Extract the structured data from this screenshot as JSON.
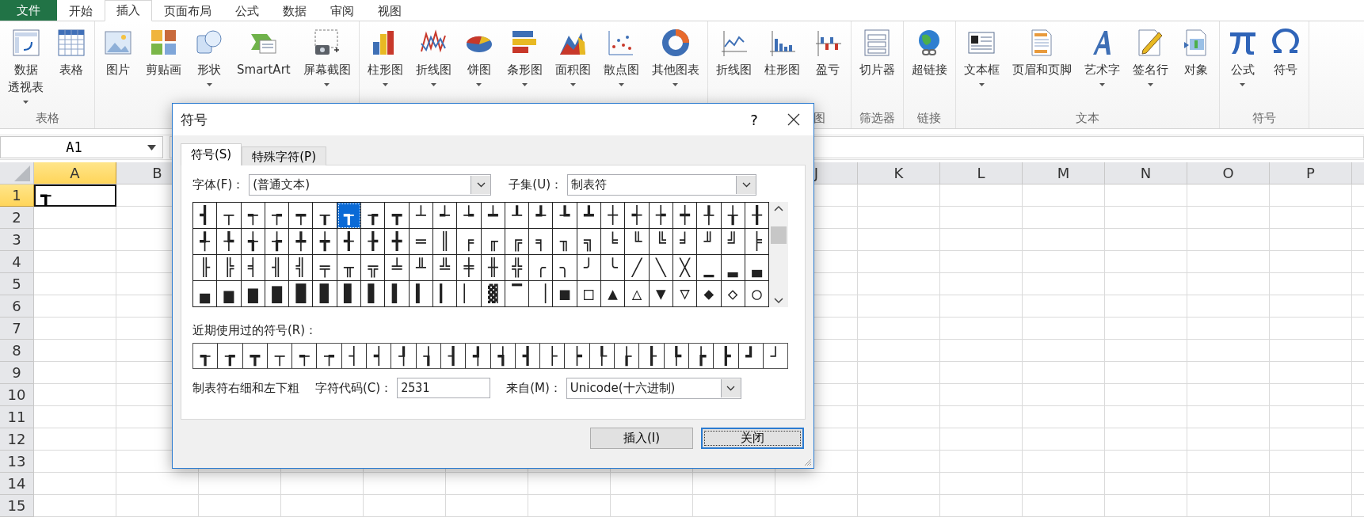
{
  "ribbon": {
    "tabs": [
      {
        "label": "文件",
        "kind": "file",
        "selected": false
      },
      {
        "label": "开始",
        "kind": "tab",
        "selected": false
      },
      {
        "label": "插入",
        "kind": "tab",
        "selected": true
      },
      {
        "label": "页面布局",
        "kind": "tab",
        "selected": false
      },
      {
        "label": "公式",
        "kind": "tab",
        "selected": false
      },
      {
        "label": "数据",
        "kind": "tab",
        "selected": false
      },
      {
        "label": "审阅",
        "kind": "tab",
        "selected": false
      },
      {
        "label": "视图",
        "kind": "tab",
        "selected": false
      }
    ],
    "groups": [
      {
        "label": "表格",
        "buttons": [
          {
            "lines": [
              "数据",
              "透视表"
            ],
            "dropdown": true
          },
          {
            "label": "表格",
            "dropdown": false
          }
        ]
      },
      {
        "buttons": [
          {
            "label": "图片",
            "dropdown": false
          },
          {
            "label": "剪贴画",
            "dropdown": false
          },
          {
            "label": "形状",
            "dropdown": true
          },
          {
            "label": "SmartArt",
            "dropdown": false
          },
          {
            "label": "屏幕截图",
            "dropdown": true
          }
        ]
      },
      {
        "buttons": [
          {
            "label": "柱形图",
            "dropdown": true
          },
          {
            "label": "折线图",
            "dropdown": true
          },
          {
            "label": "饼图",
            "dropdown": true
          },
          {
            "label": "条形图",
            "dropdown": true
          },
          {
            "label": "面积图",
            "dropdown": true
          },
          {
            "label": "散点图",
            "dropdown": true
          },
          {
            "label": "其他图表",
            "dropdown": true
          }
        ]
      },
      {
        "label": "图",
        "buttons": [
          {
            "label": "折线图",
            "dropdown": false
          },
          {
            "label": "柱形图",
            "dropdown": false
          },
          {
            "label": "盈亏",
            "dropdown": false
          }
        ]
      },
      {
        "label": "筛选器",
        "buttons": [
          {
            "label": "切片器",
            "dropdown": false
          }
        ]
      },
      {
        "label": "链接",
        "buttons": [
          {
            "label": "超链接",
            "dropdown": false
          }
        ]
      },
      {
        "label": "文本",
        "buttons": [
          {
            "label": "文本框",
            "dropdown": true
          },
          {
            "label": "页眉和页脚",
            "dropdown": false
          },
          {
            "label": "艺术字",
            "dropdown": true
          },
          {
            "label": "签名行",
            "dropdown": true
          },
          {
            "label": "对象",
            "dropdown": false
          }
        ]
      },
      {
        "label": "符号",
        "buttons": [
          {
            "label": "公式",
            "dropdown": true
          },
          {
            "label": "符号",
            "dropdown": false
          }
        ]
      }
    ]
  },
  "name_box": {
    "value": "A1"
  },
  "sheet": {
    "columns_left": [
      {
        "label": "A",
        "selected": true
      },
      {
        "label": "B",
        "selected": false
      }
    ],
    "columns_right": [
      {
        "label": "J",
        "selected": false
      },
      {
        "label": "K",
        "selected": false
      },
      {
        "label": "L",
        "selected": false
      },
      {
        "label": "M",
        "selected": false
      },
      {
        "label": "N",
        "selected": false
      },
      {
        "label": "O",
        "selected": false
      },
      {
        "label": "P",
        "selected": false
      }
    ],
    "rows": [
      {
        "label": "1",
        "selected": true,
        "cells": [
          {
            "value": "┱",
            "selected": true
          }
        ]
      },
      {
        "label": "2",
        "selected": false
      },
      {
        "label": "3",
        "selected": false
      },
      {
        "label": "4",
        "selected": false
      },
      {
        "label": "5",
        "selected": false
      },
      {
        "label": "6",
        "selected": false
      },
      {
        "label": "7",
        "selected": false
      },
      {
        "label": "8",
        "selected": false
      },
      {
        "label": "9",
        "selected": false
      },
      {
        "label": "10",
        "selected": false
      },
      {
        "label": "11",
        "selected": false
      },
      {
        "label": "12",
        "selected": false
      },
      {
        "label": "13",
        "selected": false
      },
      {
        "label": "14",
        "selected": false
      },
      {
        "label": "15",
        "selected": false
      }
    ]
  },
  "dialog": {
    "title": "符号",
    "help": "?",
    "tabs": [
      {
        "label": "符号(S)",
        "selected": true
      },
      {
        "label": "特殊字符(P)",
        "selected": false
      }
    ],
    "font": {
      "label": "字体(F)：",
      "value": "(普通文本)"
    },
    "subset": {
      "label": "子集(U)：",
      "value": "制表符"
    },
    "symbols": [
      [
        {
          "symbol": "┫",
          "selected": false
        },
        {
          "symbol": "┬",
          "selected": false
        },
        {
          "symbol": "┭",
          "selected": false
        },
        {
          "symbol": "┮",
          "selected": false
        },
        {
          "symbol": "┯",
          "selected": false
        },
        {
          "symbol": "┰",
          "selected": false
        },
        {
          "symbol": "┱",
          "selected": true
        },
        {
          "symbol": "┲",
          "selected": false
        },
        {
          "symbol": "┳",
          "selected": false
        },
        {
          "symbol": "┴",
          "selected": false
        },
        {
          "symbol": "┵",
          "selected": false
        },
        {
          "symbol": "┶",
          "selected": false
        },
        {
          "symbol": "┷",
          "selected": false
        },
        {
          "symbol": "┸",
          "selected": false
        },
        {
          "symbol": "┹",
          "selected": false
        },
        {
          "symbol": "┺",
          "selected": false
        },
        {
          "symbol": "┻",
          "selected": false
        },
        {
          "symbol": "┼",
          "selected": false
        },
        {
          "symbol": "┽",
          "selected": false
        },
        {
          "symbol": "┾",
          "selected": false
        },
        {
          "symbol": "┿",
          "selected": false
        },
        {
          "symbol": "╀",
          "selected": false
        },
        {
          "symbol": "╁",
          "selected": false
        },
        {
          "symbol": "╂",
          "selected": false
        }
      ],
      [
        {
          "symbol": "╃",
          "selected": false
        },
        {
          "symbol": "╄",
          "selected": false
        },
        {
          "symbol": "╅",
          "selected": false
        },
        {
          "symbol": "╆",
          "selected": false
        },
        {
          "symbol": "╇",
          "selected": false
        },
        {
          "symbol": "╈",
          "selected": false
        },
        {
          "symbol": "╉",
          "selected": false
        },
        {
          "symbol": "╊",
          "selected": false
        },
        {
          "symbol": "╋",
          "selected": false
        },
        {
          "symbol": "═",
          "selected": false
        },
        {
          "symbol": "║",
          "selected": false
        },
        {
          "symbol": "╒",
          "selected": false
        },
        {
          "symbol": "╓",
          "selected": false
        },
        {
          "symbol": "╔",
          "selected": false
        },
        {
          "symbol": "╕",
          "selected": false
        },
        {
          "symbol": "╖",
          "selected": false
        },
        {
          "symbol": "╗",
          "selected": false
        },
        {
          "symbol": "╘",
          "selected": false
        },
        {
          "symbol": "╙",
          "selected": false
        },
        {
          "symbol": "╚",
          "selected": false
        },
        {
          "symbol": "╛",
          "selected": false
        },
        {
          "symbol": "╜",
          "selected": false
        },
        {
          "symbol": "╝",
          "selected": false
        },
        {
          "symbol": "╞",
          "selected": false
        }
      ],
      [
        {
          "symbol": "╟",
          "selected": false
        },
        {
          "symbol": "╠",
          "selected": false
        },
        {
          "symbol": "╡",
          "selected": false
        },
        {
          "symbol": "╢",
          "selected": false
        },
        {
          "symbol": "╣",
          "selected": false
        },
        {
          "symbol": "╤",
          "selected": false
        },
        {
          "symbol": "╥",
          "selected": false
        },
        {
          "symbol": "╦",
          "selected": false
        },
        {
          "symbol": "╧",
          "selected": false
        },
        {
          "symbol": "╨",
          "selected": false
        },
        {
          "symbol": "╩",
          "selected": false
        },
        {
          "symbol": "╪",
          "selected": false
        },
        {
          "symbol": "╫",
          "selected": false
        },
        {
          "symbol": "╬",
          "selected": false
        },
        {
          "symbol": "╭",
          "selected": false
        },
        {
          "symbol": "╮",
          "selected": false
        },
        {
          "symbol": "╯",
          "selected": false
        },
        {
          "symbol": "╰",
          "selected": false
        },
        {
          "symbol": "╱",
          "selected": false
        },
        {
          "symbol": "╲",
          "selected": false
        },
        {
          "symbol": "╳",
          "selected": false
        },
        {
          "symbol": "▁",
          "selected": false
        },
        {
          "symbol": "▂",
          "selected": false
        },
        {
          "symbol": "▃",
          "selected": false
        }
      ],
      [
        {
          "symbol": "▄",
          "selected": false
        },
        {
          "symbol": "▅",
          "selected": false
        },
        {
          "symbol": "▆",
          "selected": false
        },
        {
          "symbol": "▇",
          "selected": false
        },
        {
          "symbol": "█",
          "selected": false
        },
        {
          "symbol": "▉",
          "selected": false
        },
        {
          "symbol": "▊",
          "selected": false
        },
        {
          "symbol": "▋",
          "selected": false
        },
        {
          "symbol": "▌",
          "selected": false
        },
        {
          "symbol": "▍",
          "selected": false
        },
        {
          "symbol": "▎",
          "selected": false
        },
        {
          "symbol": "▏",
          "selected": false
        },
        {
          "symbol": "▓",
          "selected": false
        },
        {
          "symbol": "▔",
          "selected": false
        },
        {
          "symbol": "▕",
          "selected": false
        },
        {
          "symbol": "■",
          "selected": false
        },
        {
          "symbol": "□",
          "selected": false
        },
        {
          "symbol": "▲",
          "selected": false
        },
        {
          "symbol": "△",
          "selected": false
        },
        {
          "symbol": "▼",
          "selected": false
        },
        {
          "symbol": "▽",
          "selected": false
        },
        {
          "symbol": "◆",
          "selected": false
        },
        {
          "symbol": "◇",
          "selected": false
        },
        {
          "symbol": "○",
          "selected": false
        }
      ]
    ],
    "recent_label": "近期使用过的符号(R)：",
    "recent": [
      "┱",
      "┲",
      "┳",
      "┬",
      "┭",
      "┮",
      "┤",
      "┥",
      "┦",
      "┧",
      "┨",
      "┩",
      "┪",
      "┫",
      "├",
      "┝",
      "┞",
      "┟",
      "┠",
      "┡",
      "┢",
      "┣",
      "┛",
      "┘"
    ],
    "description": "制表符右细和左下粗",
    "char_code": {
      "label": "字符代码(C)：",
      "value": "2531"
    },
    "from": {
      "label": "来自(M)：",
      "value": "Unicode(十六进制)"
    },
    "buttons": [
      {
        "label": "插入(I)",
        "default": false
      },
      {
        "label": "关闭",
        "default": true
      }
    ]
  }
}
